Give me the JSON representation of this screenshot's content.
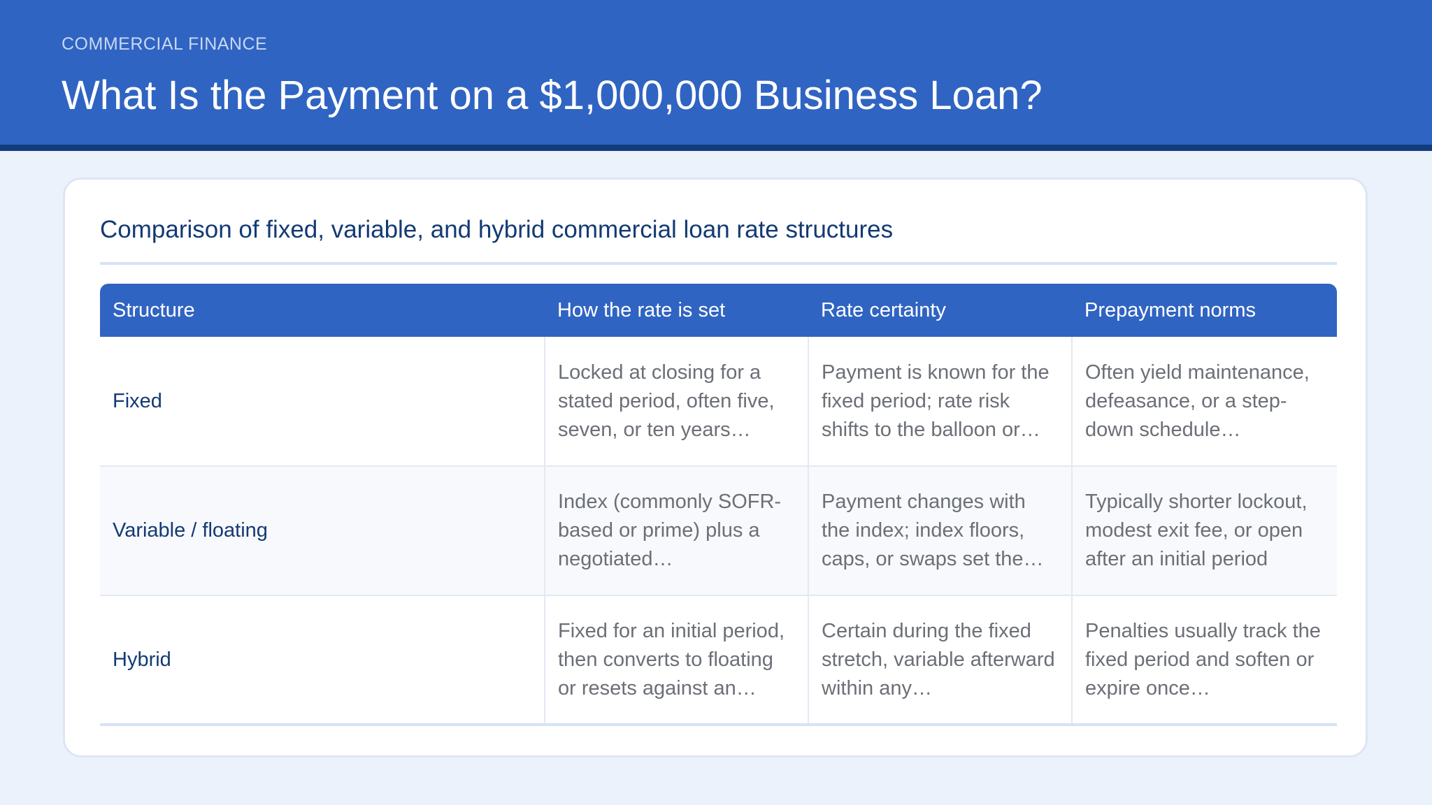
{
  "header": {
    "eyebrow": "COMMERCIAL FINANCE",
    "title": "What Is the Payment on a $1,000,000 Business Loan?"
  },
  "card": {
    "title": "Comparison of fixed, variable, and hybrid commercial loan rate structures"
  },
  "table": {
    "columns": [
      "Structure",
      "How the rate is set",
      "Rate certainty",
      "Prepayment norms"
    ],
    "rows": [
      {
        "structure": "Fixed",
        "how": "Locked at closing for a stated period, often five, seven, or ten years…",
        "certainty": "Payment is known for the fixed period; rate risk shifts to the balloon or…",
        "prepayment": "Often yield maintenance, defeasance, or a step-down schedule…"
      },
      {
        "structure": "Variable / floating",
        "how": "Index (commonly SOFR-based or prime) plus a negotiated…",
        "certainty": "Payment changes with the index; index floors, caps, or swaps set the…",
        "prepayment": "Typically shorter lockout, modest exit fee, or open after an initial period"
      },
      {
        "structure": "Hybrid",
        "how": "Fixed for an initial period, then converts to floating or resets against an…",
        "certainty": "Certain during the fixed stretch, variable afterward within any…",
        "prepayment": "Penalties usually track the fixed period and soften or expire once…"
      }
    ]
  },
  "colors": {
    "header_bg": "#3064c2",
    "header_rule": "#123c7c",
    "page_bg": "#ebf2fc",
    "title_text": "#133a73",
    "body_text": "#6b6f76"
  }
}
